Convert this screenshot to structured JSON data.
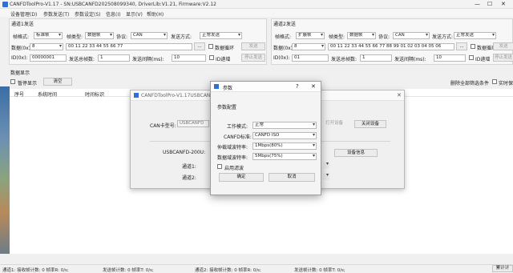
{
  "window": {
    "title": "CANFDToolPro-V1.17 - SN:USBCANFD202508099340, DriverLib:V1.21, Firmware:V2.12",
    "controls": [
      "—",
      "☐",
      "✕"
    ]
  },
  "menu": [
    "设备管理(D)",
    "参数发送(T)",
    "参数设定(S)",
    "信息(I)",
    "显示(V)",
    "帮助(H)"
  ],
  "channel1": {
    "title": "通道1发送",
    "frame_format_label": "帧格式:",
    "frame_format": "标准帧",
    "frame_type_label": "帧类型:",
    "frame_type": "数据帧",
    "protocol_label": "协议:",
    "protocol": "CAN",
    "send_mode_label": "发送方式:",
    "send_mode": "正常发送",
    "length_label": "数据(0x):",
    "length": "8",
    "data": "00 11 22 33 44 55 66 77",
    "browse": "...",
    "file_label": "数据循环",
    "send": "发送",
    "id_label": "ID(0x):",
    "id": "00000001",
    "count_label": "发送总帧数:",
    "count": "1",
    "interval_label": "发送间隔(ms):",
    "interval": "10",
    "id_inc_label": "ID递增",
    "stop": "停止发送"
  },
  "channel2": {
    "title": "通道2发送",
    "frame_format_label": "帧格式:",
    "frame_format": "扩展帧",
    "frame_type_label": "帧类型:",
    "frame_type": "数据帧",
    "protocol_label": "协议:",
    "protocol": "CAN",
    "send_mode_label": "发送方式:",
    "send_mode": "正常发送",
    "length_label": "数据(0x):",
    "length": "8",
    "data": "00 11 22 33 44 55 66 77 88 99 01 02 03 04 05 06",
    "browse": "...",
    "file_label": "数据循环",
    "send": "发送",
    "id_label": "ID(0x):",
    "id": "01",
    "count_label": "发送总帧数:",
    "count": "1",
    "interval_label": "发送间隔(ms):",
    "interval": "10",
    "id_inc_label": "ID递增",
    "stop": "停止发送"
  },
  "display": {
    "title": "数据显示",
    "pause_label": "暂停显示",
    "clear": "清空",
    "delete_filter": "删除全部筛选条件",
    "realtime_label": "实时保存",
    "columns": [
      "序号",
      "系统时间",
      "时间标识"
    ]
  },
  "device_dialog": {
    "title": "CANFDToolPro-V1.17USBCANFD-...",
    "card_label": "CAN卡型号:",
    "card": "USBCANFD",
    "open": "打开设备",
    "close": "关闭设备",
    "device_label": "USBCANFD-200U:",
    "info": "设备信息",
    "ch1_label": "通道1:",
    "ch2_label": "通道2:"
  },
  "param_dialog": {
    "title": "参数",
    "help": "?",
    "close": "✕",
    "section": "参数配置",
    "mode_label": "工作模式:",
    "mode": "正常",
    "std_label": "CANFD标准:",
    "std": "CANFD ISO",
    "arb_label": "仲裁域波特率:",
    "arb": "1Mbps(80%)",
    "data_label": "数据域波特率:",
    "data": "5Mbps(75%)",
    "filter_label": "启用滤波",
    "ok": "确定",
    "cancel": "取消"
  },
  "status": {
    "ch1": "通道1: 接收帧计数:  0  帧率R:  0/s;",
    "ch1_tx": "发送帧计数:  0  帧率T:  0/s;",
    "ch2": "通道2: 接收帧计数:  0  帧率R:  0/s;",
    "ch2_tx": "发送帧计数:  0  帧率T:  0/s;",
    "right": "累计计"
  }
}
